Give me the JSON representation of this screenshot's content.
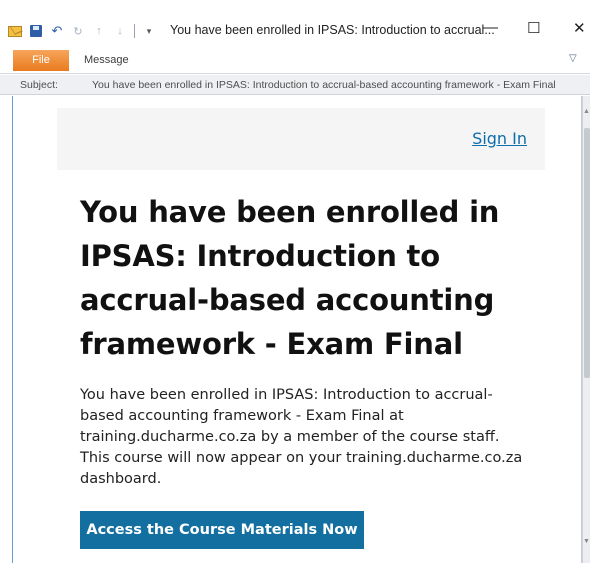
{
  "window": {
    "title": "You have been enrolled in IPSAS: Introduction to accrual...",
    "minimize": "—",
    "maximize": "☐",
    "close": "✕"
  },
  "quick_access": {
    "icons": [
      "mail-icon",
      "save-icon",
      "undo-icon",
      "redo-icon",
      "previous-icon",
      "next-icon",
      "customize-dropdown-icon"
    ]
  },
  "ribbon": {
    "tabs": [
      {
        "label": "File"
      },
      {
        "label": "Message"
      }
    ]
  },
  "header": {
    "subject_label": "Subject:",
    "subject_value": "You have been enrolled in IPSAS: Introduction to accrual-based accounting framework - Exam Final"
  },
  "email": {
    "sign_in": "Sign In",
    "title": "You have been enrolled in IPSAS: Introduction to accrual-based accounting framework - Exam Final",
    "body": "You have been enrolled in IPSAS: Introduction to accrual-based accounting framework - Exam Final at training.ducharme.co.za by a member of the course staff. This course will now appear on your training.ducharme.co.za dashboard.",
    "cta": "Access the Course Materials Now"
  },
  "colors": {
    "file_tab": "#e97b1f",
    "link": "#0e6dab",
    "cta_bg": "#126f9f"
  }
}
